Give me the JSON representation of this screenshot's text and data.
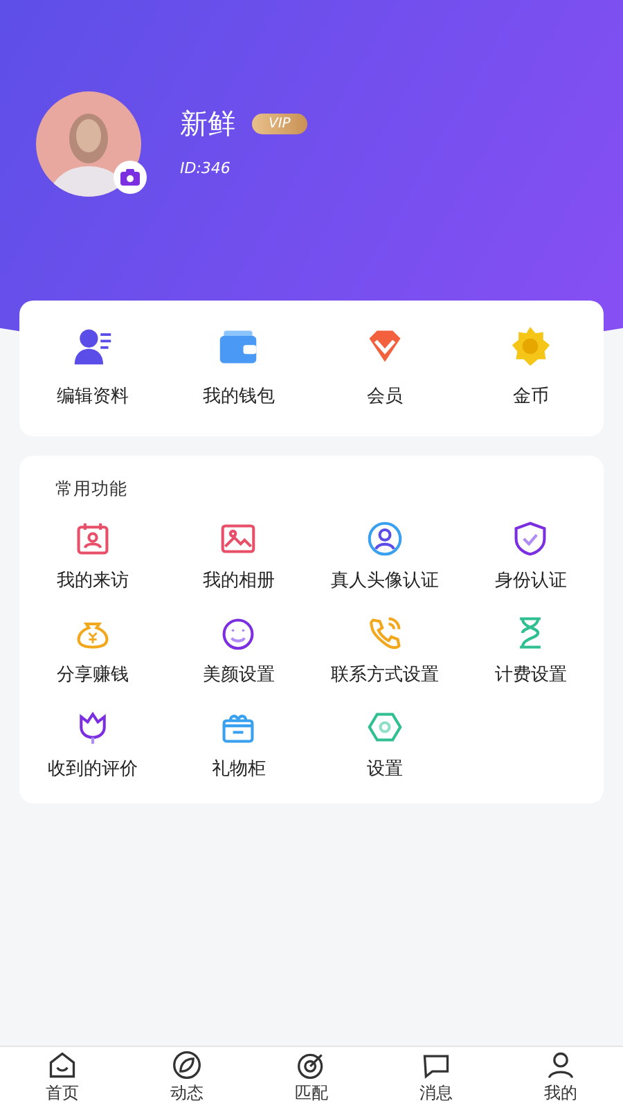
{
  "profile": {
    "name": "新鲜",
    "badge": "VIP",
    "id": "ID:346"
  },
  "quick_actions": [
    {
      "label": "编辑资料"
    },
    {
      "label": "我的钱包"
    },
    {
      "label": "会员"
    },
    {
      "label": "金币"
    }
  ],
  "common_functions": {
    "title": "常用功能",
    "items": [
      {
        "label": "我的来访"
      },
      {
        "label": "我的相册"
      },
      {
        "label": "真人头像认证"
      },
      {
        "label": "身份认证"
      },
      {
        "label": "分享赚钱"
      },
      {
        "label": "美颜设置"
      },
      {
        "label": "联系方式设置"
      },
      {
        "label": "计费设置"
      },
      {
        "label": "收到的评价"
      },
      {
        "label": "礼物柜"
      },
      {
        "label": "设置"
      }
    ]
  },
  "tab_bar": [
    {
      "label": "首页"
    },
    {
      "label": "动态"
    },
    {
      "label": "匹配"
    },
    {
      "label": "消息"
    },
    {
      "label": "我的"
    }
  ]
}
